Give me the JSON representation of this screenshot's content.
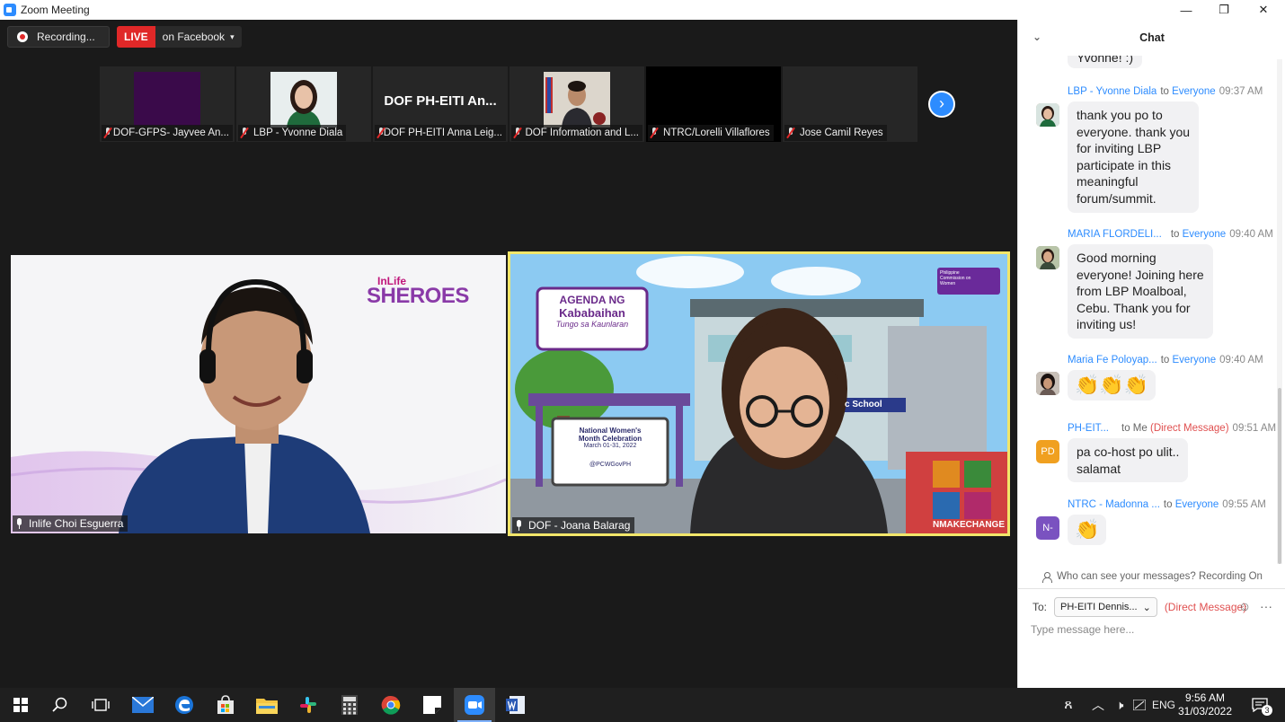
{
  "window": {
    "title": "Zoom Meeting",
    "minimize": "—",
    "restore": "❐",
    "close": "✕"
  },
  "toolbar": {
    "recording_label": "Recording...",
    "live_label": "LIVE",
    "live_destination": "on Facebook",
    "dropdown_glyph": "▾"
  },
  "participants_strip": {
    "next_glyph": "›",
    "thumbs": [
      {
        "name": "DOF-GFPS- Jayvee An...",
        "video": "purple-card"
      },
      {
        "name": "LBP - Yvonne Diala",
        "video": "person"
      },
      {
        "name": "DOF PH-EITI Anna Leig...",
        "video": "name-card",
        "card_text": "DOF PH-EITI An..."
      },
      {
        "name": "DOF Information and L...",
        "video": "person-flags"
      },
      {
        "name": "NTRC/Lorelli Villaflores",
        "video": "black"
      },
      {
        "name": "Jose Camil Reyes",
        "video": "empty"
      }
    ]
  },
  "main_tiles": [
    {
      "name": "Inlife Choi Esguerra",
      "logo_top": "InLife",
      "logo_main": "SHEROES"
    },
    {
      "name": "DOF - Joana Balarag",
      "poster_line1": "AGENDA NG",
      "poster_line2": "Kababaihan",
      "poster_line3": "Tungo sa Kaunlaran",
      "board_line1": "National Women's",
      "board_line2": "Month Celebration",
      "board_line3": "March 01-31, 2022",
      "board_handle": "@PCWGovPH",
      "school_sign": "c School",
      "org_text": "Philippine Commission on Women",
      "hashtag": "NMAKECHANGE"
    }
  ],
  "chat": {
    "title": "Chat",
    "collapse_glyph": "⌄",
    "partial_message": "Yvonne! :)",
    "messages": [
      {
        "sender": "LBP - Yvonne Diala",
        "to": "to",
        "target": "Everyone",
        "time": "09:37 AM",
        "text_lines": [
          "thank you po to",
          "everyone. thank you",
          "for inviting LBP",
          "participate in this",
          "meaningful",
          "forum/summit."
        ],
        "avatar": "photo",
        "avatar_color": "#c9a58a"
      },
      {
        "sender": "MARIA FLORDELI...",
        "to": "to",
        "target": "Everyone",
        "time": "09:40 AM",
        "text_lines": [
          "Good morning",
          "everyone! Joining here",
          "from LBP Moalboal,",
          "Cebu.  Thank you for",
          "inviting us!"
        ],
        "avatar": "photo",
        "avatar_color": "#7c8d6e"
      },
      {
        "sender": "Maria Fe Poloyap...",
        "to": "to",
        "target": "Everyone",
        "time": "09:40 AM",
        "emoji": "👏👏👏",
        "avatar": "photo",
        "avatar_color": "#5a4a44"
      },
      {
        "sender": "PH-EIT...",
        "to": "to Me",
        "target": "(Direct Message)",
        "time": "09:51 AM",
        "text_lines": [
          "pa co-host po ulit..",
          "salamat"
        ],
        "avatar": "initials",
        "initials": "PD",
        "avatar_color": "#f0a020",
        "dm": true
      },
      {
        "sender": "NTRC - Madonna ...",
        "to": "to",
        "target": "Everyone",
        "time": "09:55 AM",
        "emoji": "👏",
        "avatar": "initials",
        "initials": "N-",
        "avatar_color": "#7a52c0"
      }
    ],
    "visibility_note": "Who can see your messages? Recording On",
    "to_label": "To:",
    "recipient": "PH-EITI Dennis...",
    "recipient_glyph": "⌄",
    "recipient_note": "(Direct Message)",
    "emoji_glyph": "☺",
    "more_glyph": "···",
    "input_placeholder": "Type message here..."
  },
  "taskbar": {
    "start_icon": "windows-logo-icon",
    "language": "ENG",
    "time": "9:56 AM",
    "date": "31/03/2022",
    "notification_count": "3",
    "tray_up_glyph": "︿",
    "tray_people_glyph": "ጸ",
    "tray_volume_glyph": "🕨"
  },
  "colors": {
    "zoom_blue": "#2d8cff",
    "live_red": "#e02828",
    "active_speaker": "#f2e66a",
    "dm_red": "#e05050"
  }
}
